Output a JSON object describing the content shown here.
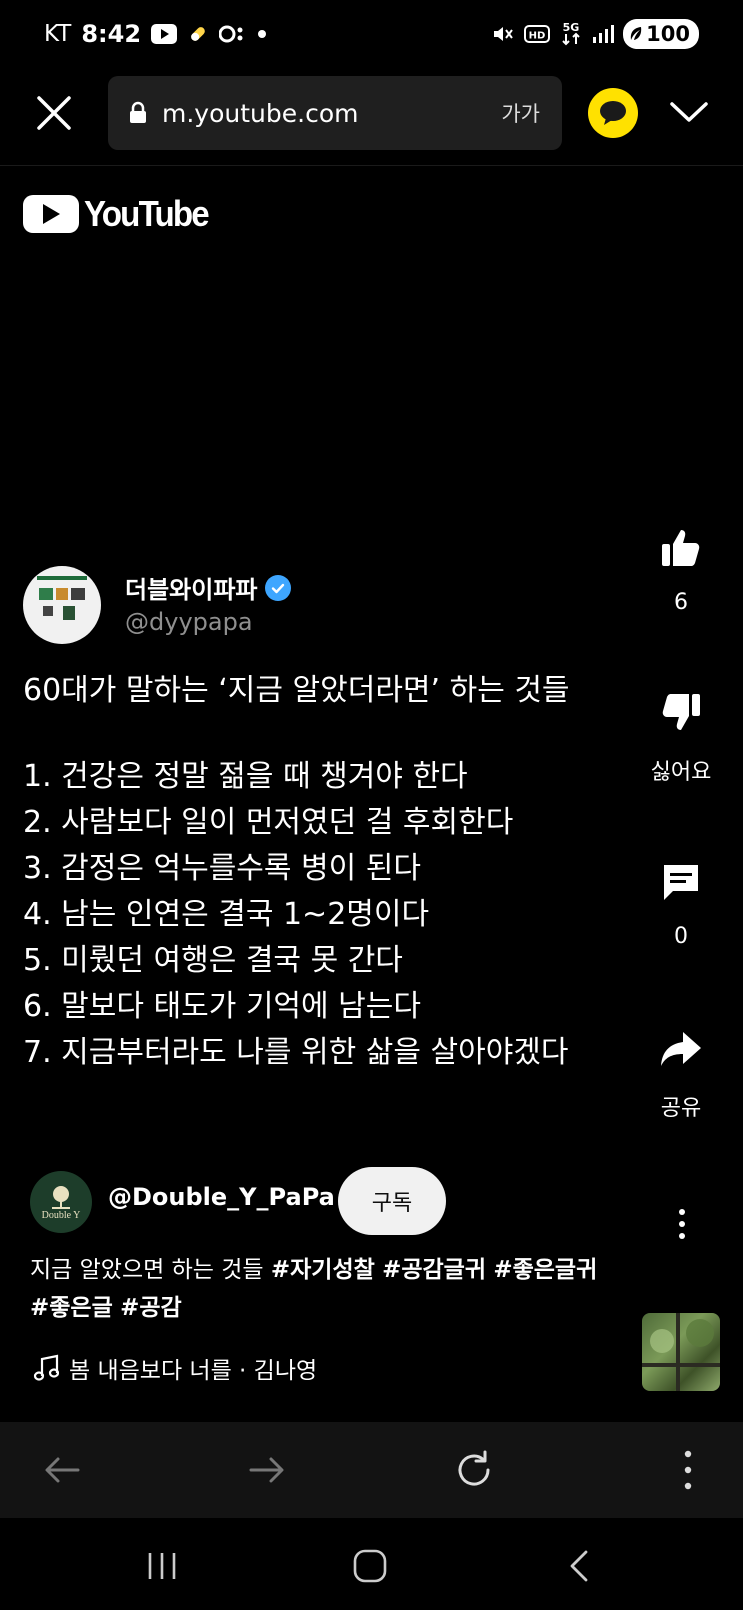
{
  "status_bar": {
    "carrier": "KT",
    "time": "8:42",
    "network": "5G",
    "hd": "HD",
    "battery": "100"
  },
  "browser": {
    "url": "m.youtube.com",
    "text_size_label": "가가"
  },
  "youtube": {
    "logo_text": "YouTube"
  },
  "post": {
    "channel_name": "더블와이파파",
    "handle": "@dyypapa",
    "title": "60대가 말하는 ‘지금 알았더라면’ 하는 것들",
    "items": [
      "1. 건강은 정말 젊을 때 챙겨야 한다",
      "2. 사람보다 일이 먼저였던 걸 후회한다",
      "3. 감정은 억누를수록 병이 된다",
      "4. 남는 인연은 결국 1~2명이다",
      "5. 미뤘던 여행은 결국 못 간다",
      "6. 말보다 태도가 기억에 남는다",
      "7. 지금부터라도 나를 위한 삶을 살아야겠다"
    ]
  },
  "actions": {
    "like_count": "6",
    "dislike_label": "싫어요",
    "comment_count": "0",
    "share_label": "공유"
  },
  "channel": {
    "avatar_text": "Double Y",
    "handle": "@Double_Y_PaPa",
    "subscribe_label": "구독"
  },
  "description": {
    "text": "지금 알았으면 하는 것들 ",
    "hashtags": [
      "#자기성찰",
      "#공감글귀",
      "#좋은글귀",
      "#좋은글",
      "#공감"
    ]
  },
  "music": {
    "title": "봄 내음보다 너를 · 김나영"
  },
  "colors": {
    "background": "#000000",
    "url_bar": "#1f1f1f",
    "talk_button": "#ffe100",
    "verified": "#3ea6ff",
    "handle_gray": "#8f8f8f",
    "subscribe_bg": "#f1f1f1",
    "nav_bar": "#131313"
  },
  "icons": {
    "close": "close-icon",
    "lock": "lock-icon",
    "talk": "speech-bubble-icon",
    "chevron": "chevron-down-icon",
    "like": "thumbs-up-icon",
    "dislike": "thumbs-down-icon",
    "comment": "comment-icon",
    "share": "share-arrow-icon",
    "more": "more-vertical-icon",
    "music": "music-note-icon",
    "back": "arrow-left-icon",
    "forward": "arrow-right-icon",
    "refresh": "refresh-icon"
  }
}
